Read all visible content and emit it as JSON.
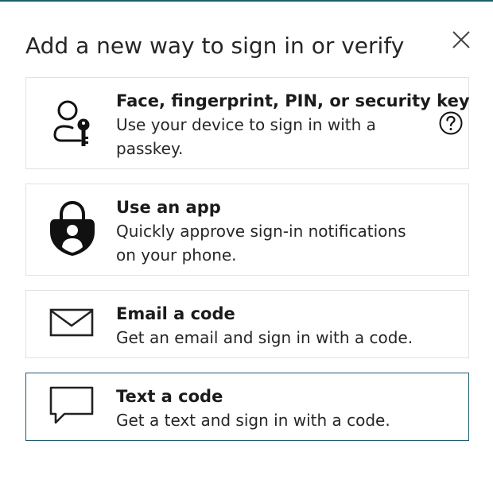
{
  "dialog": {
    "title": "Add a new way to sign in or verify",
    "close_icon": "close-icon"
  },
  "options": [
    {
      "title": "Face, fingerprint, PIN, or security key",
      "description": "Use your device to sign in with a passkey.",
      "icon": "passkey-person-key-icon",
      "help_icon": "question-circle-icon"
    },
    {
      "title": "Use an app",
      "description": "Quickly approve sign-in notifications on your phone.",
      "icon": "authenticator-app-lock-icon"
    },
    {
      "title": "Email a code",
      "description": "Get an email and sign in with a code.",
      "icon": "envelope-icon"
    },
    {
      "title": "Text a code",
      "description": "Get a text and sign in with a code.",
      "icon": "chat-bubble-icon",
      "selected": true
    }
  ],
  "colors": {
    "accent_border": "#1f5c6f",
    "card_border": "#e1e1e1",
    "text": "#1b1b1b"
  }
}
